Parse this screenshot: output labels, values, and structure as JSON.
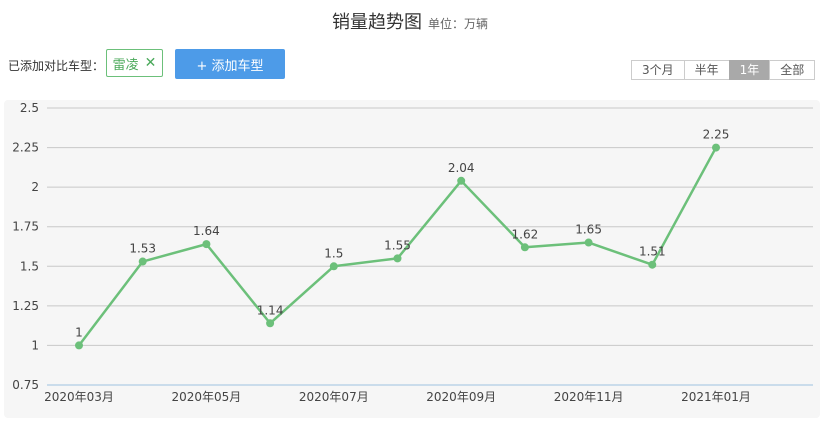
{
  "header": {
    "title": "销量趋势图",
    "unit": "单位：万辆"
  },
  "compare": {
    "label": "已添加对比车型：",
    "model": "雷凌",
    "add_label": "+ 添加车型"
  },
  "range": {
    "options": [
      "3个月",
      "半年",
      "1年",
      "全部"
    ],
    "selected": "1年"
  },
  "colors": {
    "line": "#6cc07a",
    "button": "#4d9be8",
    "grid": "#c8c8c8"
  },
  "chart_data": {
    "type": "line",
    "x": [
      "2020年03月",
      "2020年04月",
      "2020年05月",
      "2020年06月",
      "2020年07月",
      "2020年08月",
      "2020年09月",
      "2020年10月",
      "2020年11月",
      "2020年12月",
      "2021年01月"
    ],
    "values": [
      1,
      1.53,
      1.64,
      1.14,
      1.5,
      1.55,
      2.04,
      1.62,
      1.65,
      1.51,
      2.25
    ],
    "x_tick_labels": [
      "2020年03月",
      "2020年05月",
      "2020年07月",
      "2020年09月",
      "2020年11月",
      "2021年01月"
    ],
    "y_ticks": [
      0.75,
      1,
      1.25,
      1.5,
      1.75,
      2,
      2.25,
      2.5
    ],
    "ylim": [
      0.75,
      2.5
    ],
    "grid": true
  }
}
